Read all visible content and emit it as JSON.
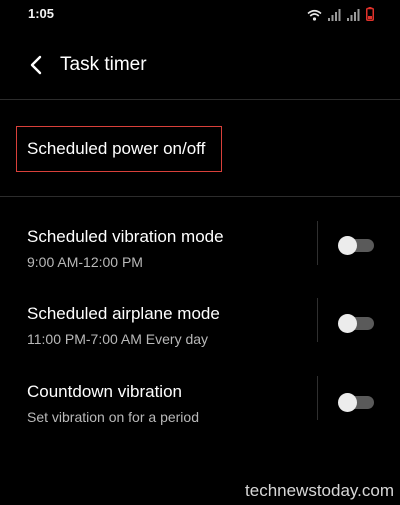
{
  "status_bar": {
    "time": "1:05",
    "icons": [
      "wifi-icon",
      "signal-icon",
      "signal-icon",
      "battery-low-icon"
    ],
    "battery_color": "#e0322b"
  },
  "header": {
    "back_icon": "chevron-left-icon",
    "title": "Task timer"
  },
  "power": {
    "label": "Scheduled power on/off",
    "highlight_color": "#d9403a"
  },
  "settings": [
    {
      "title": "Scheduled vibration mode",
      "subtitle": "9:00 AM-12:00 PM",
      "enabled": false
    },
    {
      "title": "Scheduled airplane mode",
      "subtitle": "11:00 PM-7:00 AM Every day",
      "enabled": false
    },
    {
      "title": "Countdown vibration",
      "subtitle": "Set vibration on for a period",
      "enabled": false
    }
  ],
  "watermark": "technewstoday.com"
}
